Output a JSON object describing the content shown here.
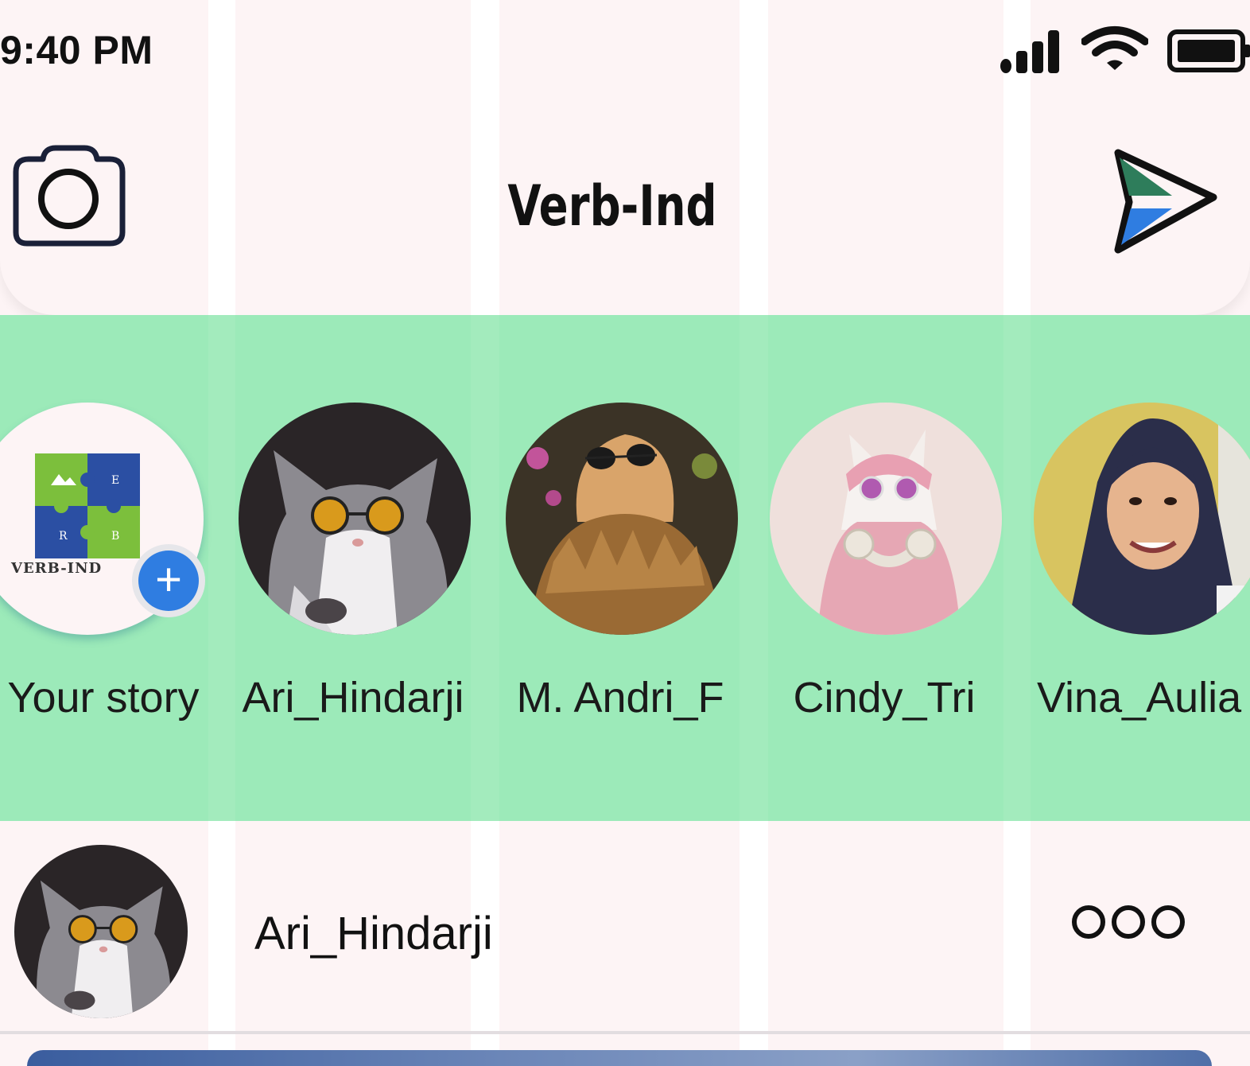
{
  "status_bar": {
    "time": "9:40 PM",
    "signal_icon": "cellular-signal-icon",
    "wifi_icon": "wifi-icon",
    "battery_icon": "battery-icon"
  },
  "header": {
    "title": "Verb-Ind",
    "camera_icon": "camera-icon",
    "send_icon": "send-icon"
  },
  "stories": [
    {
      "name": "Your story",
      "avatar": "verb-ind-logo",
      "is_own": true,
      "add_icon": "plus-icon"
    },
    {
      "name": "Ari_Hindarji",
      "avatar": "cat-with-round-sunglasses"
    },
    {
      "name": "M. Andri_F",
      "avatar": "cat-with-fur-collar"
    },
    {
      "name": "Cindy_Tri",
      "avatar": "cat-in-pink-hoodie-with-headphones"
    },
    {
      "name": "Vina_Aulia",
      "avatar": "woman-in-hijab"
    }
  ],
  "logo": {
    "text": "VERB-IND"
  },
  "post": {
    "author": "Ari_Hindarji",
    "avatar": "cat-with-round-sunglasses",
    "more_icon": "more-options-icon"
  },
  "colors": {
    "stories_background": "#9ceab9",
    "page_background": "#fdf4f5",
    "accent_blue": "#2f7de1"
  }
}
